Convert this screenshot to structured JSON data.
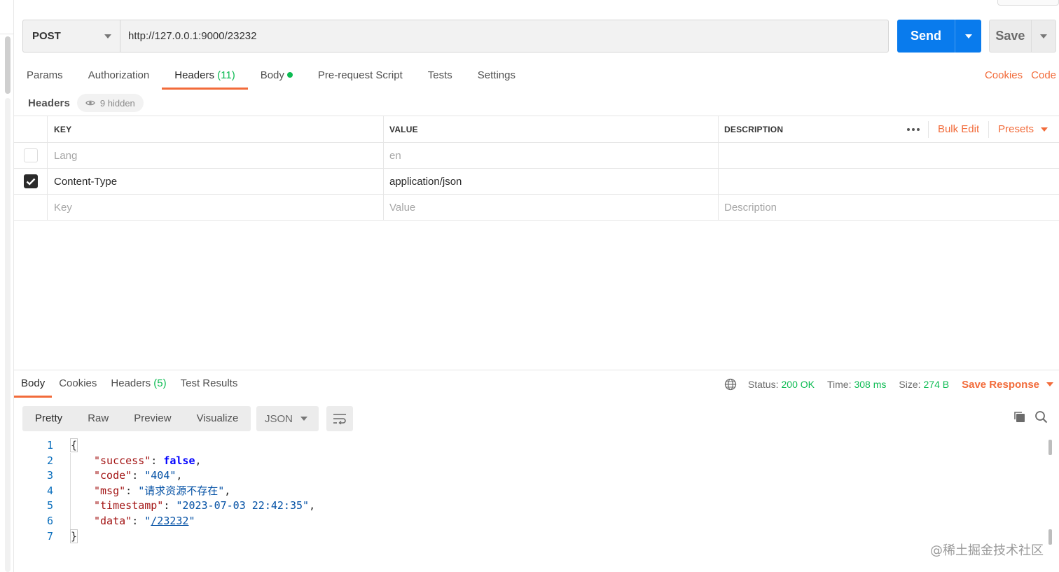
{
  "request": {
    "method": "POST",
    "url": "http://127.0.0.1:9000/23232",
    "send_label": "Send",
    "save_label": "Save"
  },
  "request_tabs": [
    {
      "label": "Params"
    },
    {
      "label": "Authorization"
    },
    {
      "label": "Headers",
      "count": "(11)"
    },
    {
      "label": "Body"
    },
    {
      "label": "Pre-request Script"
    },
    {
      "label": "Tests"
    },
    {
      "label": "Settings"
    }
  ],
  "request_links": {
    "cookies": "Cookies",
    "code": "Code"
  },
  "headers_section": {
    "title": "Headers",
    "hidden": "9 hidden",
    "columns": {
      "key": "KEY",
      "value": "VALUE",
      "description": "DESCRIPTION"
    },
    "bulk_edit": "Bulk Edit",
    "presets": "Presets",
    "rows": [
      {
        "key": "Lang",
        "value": "en",
        "description": "",
        "checked": false
      },
      {
        "key": "Content-Type",
        "value": "application/json",
        "description": "",
        "checked": true
      }
    ],
    "placeholders": {
      "key": "Key",
      "value": "Value",
      "description": "Description"
    }
  },
  "response": {
    "tabs": [
      {
        "label": "Body"
      },
      {
        "label": "Cookies"
      },
      {
        "label": "Headers",
        "count": "(5)"
      },
      {
        "label": "Test Results"
      }
    ],
    "status_label": "Status:",
    "status_value": "200 OK",
    "time_label": "Time:",
    "time_value": "308 ms",
    "size_label": "Size:",
    "size_value": "274 B",
    "save_response": "Save Response",
    "views": [
      "Pretty",
      "Raw",
      "Preview",
      "Visualize"
    ],
    "format": "JSON",
    "body_lines": {
      "l1": "{",
      "success_key": "\"success\"",
      "success_val": "false",
      "code_key": "\"code\"",
      "code_val": "\"404\"",
      "msg_key": "\"msg\"",
      "msg_val": "\"请求资源不存在\"",
      "timestamp_key": "\"timestamp\"",
      "timestamp_val": "\"2023-07-03 22:42:35\"",
      "data_key": "\"data\"",
      "data_val": "/23232",
      "l7": "}"
    },
    "line_numbers": [
      "1",
      "2",
      "3",
      "4",
      "5",
      "6",
      "7"
    ]
  },
  "watermark": "@稀土掘金技术社区",
  "colors": {
    "accent": "#f26b3a",
    "send": "#097bed",
    "success": "#0cbb52"
  }
}
